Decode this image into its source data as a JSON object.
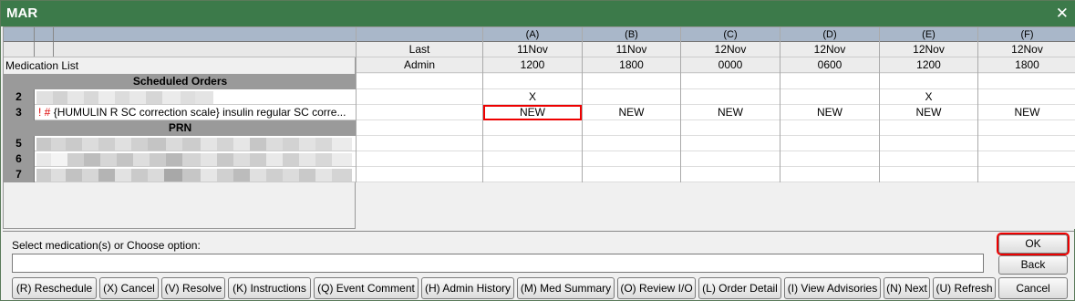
{
  "window": {
    "title": "MAR",
    "close": "✕"
  },
  "left": {
    "medication_list_label": "Medication List",
    "scheduled_header": "Scheduled Orders",
    "prn_header": "PRN",
    "rows": [
      {
        "num": "2",
        "flag": "",
        "text": ""
      },
      {
        "num": "3",
        "flag": "! #",
        "text": "{HUMULIN R SC correction scale} insulin regular SC corre..."
      },
      {
        "num": "5",
        "flag": "",
        "text": ""
      },
      {
        "num": "6",
        "flag": "",
        "text": ""
      },
      {
        "num": "7",
        "flag": "",
        "text": ""
      }
    ]
  },
  "grid": {
    "last_label": "Last",
    "admin_label": "Admin",
    "columns": [
      {
        "letter": "(A)",
        "date": "11Nov",
        "time": "1200",
        "row2": "X",
        "row3": "NEW"
      },
      {
        "letter": "(B)",
        "date": "11Nov",
        "time": "1800",
        "row2": "",
        "row3": "NEW"
      },
      {
        "letter": "(C)",
        "date": "12Nov",
        "time": "0000",
        "row2": "",
        "row3": "NEW"
      },
      {
        "letter": "(D)",
        "date": "12Nov",
        "time": "0600",
        "row2": "",
        "row3": "NEW"
      },
      {
        "letter": "(E)",
        "date": "12Nov",
        "time": "1200",
        "row2": "X",
        "row3": "NEW"
      },
      {
        "letter": "(F)",
        "date": "12Nov",
        "time": "1800",
        "row2": "",
        "row3": "NEW"
      }
    ]
  },
  "bottom": {
    "prompt": "Select medication(s) or Choose option:",
    "input_value": "",
    "ok": "OK",
    "back": "Back",
    "cancel_main": "Cancel",
    "buttons": [
      "(R) Reschedule",
      "(X) Cancel",
      "(V) Resolve",
      "(K) Instructions",
      "(Q) Event Comment",
      "(H) Admin History",
      "(M) Med Summary",
      "(O) Review I/O",
      "(L) Order Detail",
      "(I) View Advisories",
      "(N) Next",
      "(U) Refresh"
    ]
  }
}
